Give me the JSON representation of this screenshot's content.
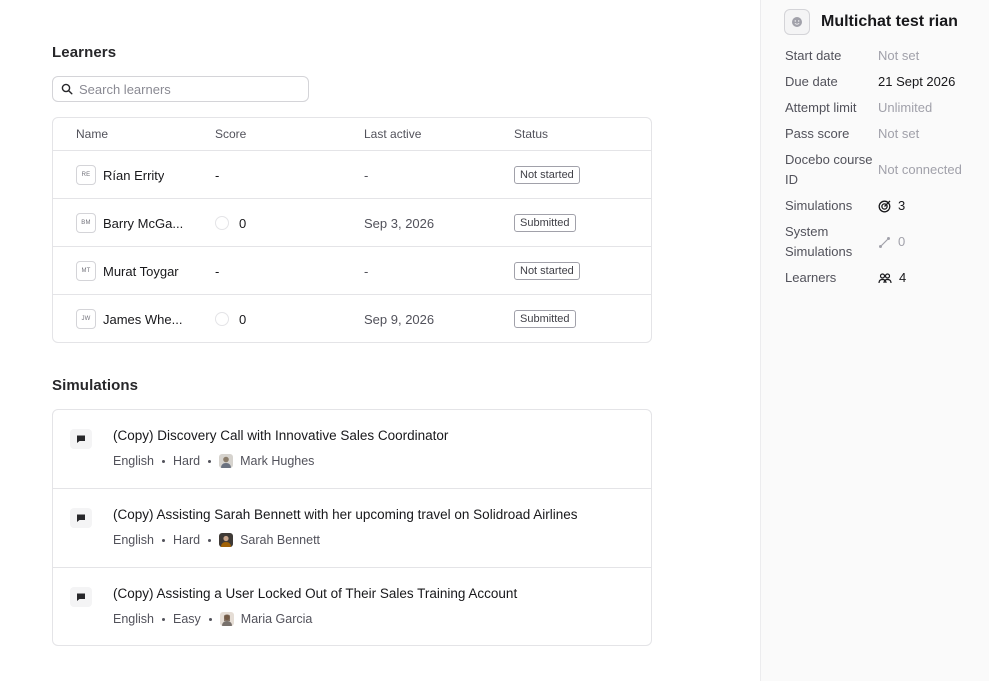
{
  "learners": {
    "title": "Learners",
    "search_placeholder": "Search learners",
    "columns": {
      "name": "Name",
      "score": "Score",
      "last_active": "Last active",
      "status": "Status"
    },
    "rows": [
      {
        "initials": "RE",
        "name": "Rían Errity",
        "score": "-",
        "last_active": "-",
        "status": "Not started"
      },
      {
        "initials": "BM",
        "name": "Barry McGa...",
        "score": "0",
        "last_active": "Sep 3, 2026",
        "status": "Submitted"
      },
      {
        "initials": "MT",
        "name": "Murat Toygar",
        "score": "-",
        "last_active": "-",
        "status": "Not started"
      },
      {
        "initials": "JW",
        "name": "James Whe...",
        "score": "0",
        "last_active": "Sep 9, 2026",
        "status": "Submitted"
      }
    ]
  },
  "simulations": {
    "title": "Simulations",
    "items": [
      {
        "title": "(Copy) Discovery Call with Innovative Sales Coordinator",
        "language": "English",
        "difficulty": "Hard",
        "persona": "Mark Hughes"
      },
      {
        "title": "(Copy) Assisting Sarah Bennett with her upcoming travel on Solidroad Airlines",
        "language": "English",
        "difficulty": "Hard",
        "persona": "Sarah Bennett"
      },
      {
        "title": "(Copy) Assisting a User Locked Out of Their Sales Training Account",
        "language": "English",
        "difficulty": "Easy",
        "persona": "Maria Garcia"
      }
    ]
  },
  "panel": {
    "title": "Multichat test rian",
    "start_date_label": "Start date",
    "start_date": "Not set",
    "due_date_label": "Due date",
    "due_date": "21 Sept 2026",
    "attempt_limit_label": "Attempt limit",
    "attempt_limit": "Unlimited",
    "pass_score_label": "Pass score",
    "pass_score": "Not set",
    "docebo_label": "Docebo course ID",
    "docebo": "Not connected",
    "simulations_label": "Simulations",
    "simulations": "3",
    "system_sims_label": "System Simulations",
    "system_sims": "0",
    "learners_label": "Learners",
    "learners": "4"
  }
}
